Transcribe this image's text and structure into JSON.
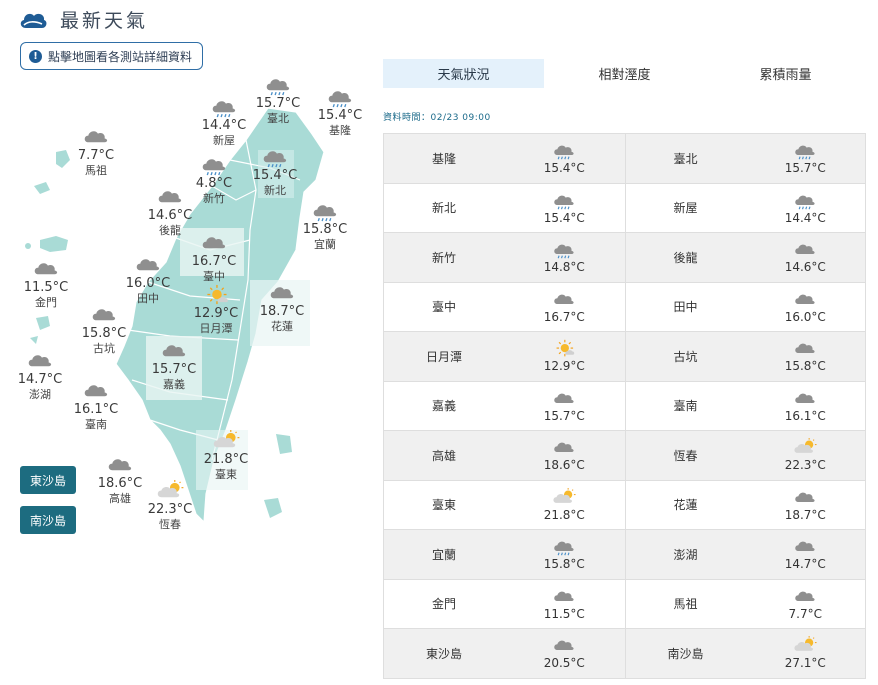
{
  "header": {
    "title": "最新天氣"
  },
  "map_button": {
    "label": "點擊地圖看各測站詳細資料"
  },
  "island_buttons": [
    "東沙島",
    "南沙島"
  ],
  "tabs": [
    {
      "label": "天氣狀況",
      "active": true
    },
    {
      "label": "相對溼度",
      "active": false
    },
    {
      "label": "累積雨量",
      "active": false
    }
  ],
  "data_time": "資料時間：02/23 09:00",
  "map_cities": [
    {
      "name": "臺北",
      "temp": "15.7°C",
      "icon": "rain"
    },
    {
      "name": "基隆",
      "temp": "15.4°C",
      "icon": "rain"
    },
    {
      "name": "新屋",
      "temp": "14.4°C",
      "icon": "rain"
    },
    {
      "name": "馬祖",
      "temp": "7.7°C",
      "icon": "cloud"
    },
    {
      "name": "新竹",
      "temp": "4.8°C",
      "icon": "rain"
    },
    {
      "name": "新北",
      "temp": "15.4°C",
      "icon": "rain"
    },
    {
      "name": "後龍",
      "temp": "14.6°C",
      "icon": "cloud"
    },
    {
      "name": "宜蘭",
      "temp": "15.8°C",
      "icon": "rain"
    },
    {
      "name": "臺中",
      "temp": "16.7°C",
      "icon": "cloud"
    },
    {
      "name": "金門",
      "temp": "11.5°C",
      "icon": "cloud"
    },
    {
      "name": "田中",
      "temp": "16.0°C",
      "icon": "cloud"
    },
    {
      "name": "日月潭",
      "temp": "12.9°C",
      "icon": "sun"
    },
    {
      "name": "花蓮",
      "temp": "18.7°C",
      "icon": "cloud"
    },
    {
      "name": "古坑",
      "temp": "15.8°C",
      "icon": "cloud"
    },
    {
      "name": "嘉義",
      "temp": "15.7°C",
      "icon": "cloud"
    },
    {
      "name": "澎湖",
      "temp": "14.7°C",
      "icon": "cloud"
    },
    {
      "name": "臺南",
      "temp": "16.1°C",
      "icon": "cloud"
    },
    {
      "name": "臺東",
      "temp": "21.8°C",
      "icon": "partly"
    },
    {
      "name": "高雄",
      "temp": "18.6°C",
      "icon": "cloud"
    },
    {
      "name": "恆春",
      "temp": "22.3°C",
      "icon": "partly"
    }
  ],
  "table_rows": [
    [
      {
        "name": "基隆",
        "temp": "15.4°C",
        "icon": "rain"
      },
      {
        "name": "臺北",
        "temp": "15.7°C",
        "icon": "rain"
      }
    ],
    [
      {
        "name": "新北",
        "temp": "15.4°C",
        "icon": "rain"
      },
      {
        "name": "新屋",
        "temp": "14.4°C",
        "icon": "rain"
      }
    ],
    [
      {
        "name": "新竹",
        "temp": "14.8°C",
        "icon": "rain"
      },
      {
        "name": "後龍",
        "temp": "14.6°C",
        "icon": "cloud"
      }
    ],
    [
      {
        "name": "臺中",
        "temp": "16.7°C",
        "icon": "cloud"
      },
      {
        "name": "田中",
        "temp": "16.0°C",
        "icon": "cloud"
      }
    ],
    [
      {
        "name": "日月潭",
        "temp": "12.9°C",
        "icon": "sun"
      },
      {
        "name": "古坑",
        "temp": "15.8°C",
        "icon": "cloud"
      }
    ],
    [
      {
        "name": "嘉義",
        "temp": "15.7°C",
        "icon": "cloud"
      },
      {
        "name": "臺南",
        "temp": "16.1°C",
        "icon": "cloud"
      }
    ],
    [
      {
        "name": "高雄",
        "temp": "18.6°C",
        "icon": "cloud"
      },
      {
        "name": "恆春",
        "temp": "22.3°C",
        "icon": "partly"
      }
    ],
    [
      {
        "name": "臺東",
        "temp": "21.8°C",
        "icon": "partly"
      },
      {
        "name": "花蓮",
        "temp": "18.7°C",
        "icon": "cloud"
      }
    ],
    [
      {
        "name": "宜蘭",
        "temp": "15.8°C",
        "icon": "rain"
      },
      {
        "name": "澎湖",
        "temp": "14.7°C",
        "icon": "cloud"
      }
    ],
    [
      {
        "name": "金門",
        "temp": "11.5°C",
        "icon": "cloud"
      },
      {
        "name": "馬祖",
        "temp": "7.7°C",
        "icon": "cloud"
      }
    ],
    [
      {
        "name": "東沙島",
        "temp": "20.5°C",
        "icon": "cloud"
      },
      {
        "name": "南沙島",
        "temp": "27.1°C",
        "icon": "partly"
      }
    ]
  ],
  "colors": {
    "accent": "#1d6c80",
    "map_land": "#a9dbd6",
    "tab_active": "#e4f1fb"
  }
}
